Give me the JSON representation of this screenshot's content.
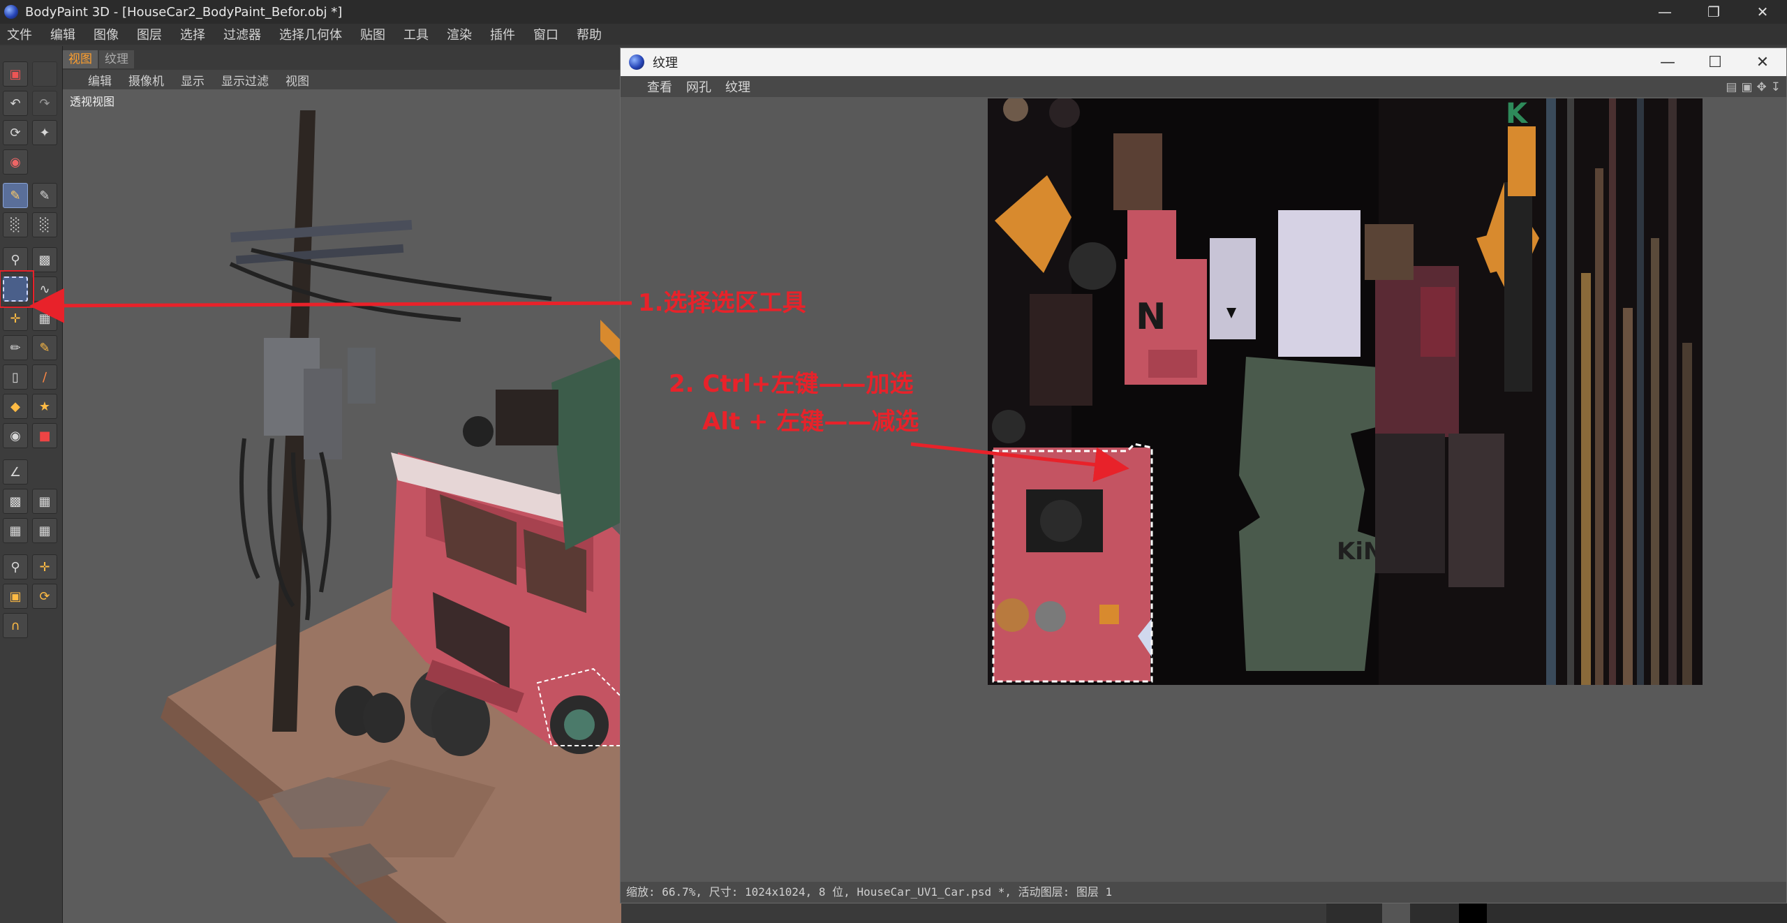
{
  "app": {
    "title": "BodyPaint 3D - [HouseCar2_BodyPaint_Befor.obj *]",
    "window_controls": [
      "minimize",
      "restore",
      "close"
    ]
  },
  "menubar": {
    "items": [
      "文件",
      "编辑",
      "图像",
      "图层",
      "选择",
      "过滤器",
      "选择几何体",
      "贴图",
      "工具",
      "渲染",
      "插件",
      "窗口",
      "帮助"
    ]
  },
  "view": {
    "tabs": [
      {
        "label": "视图",
        "active": true
      },
      {
        "label": "纹理",
        "active": false
      }
    ],
    "menu": [
      "编辑",
      "摄像机",
      "显示",
      "显示过滤",
      "视图"
    ],
    "viewport_label": "透视视图"
  },
  "texture_window": {
    "title": "纹理",
    "menu": [
      "查看",
      "网孔",
      "纹理"
    ],
    "status": "缩放: 66.7%, 尺寸: 1024x1024, 8 位, HouseCar_UV1_Car.psd *, 活动图层:  图层 1"
  },
  "annotations": {
    "step1": "1.选择选区工具",
    "step2_line1": "2. Ctrl+左键——加选",
    "step2_line2": "Alt + 左键——减选"
  },
  "colors": {
    "annotation_red": "#e8222a",
    "active_tab_orange": "#ff9f2d",
    "truck_pink": "#c45462",
    "uv_orange": "#d88a2e",
    "uv_green": "#4a5a4c"
  }
}
